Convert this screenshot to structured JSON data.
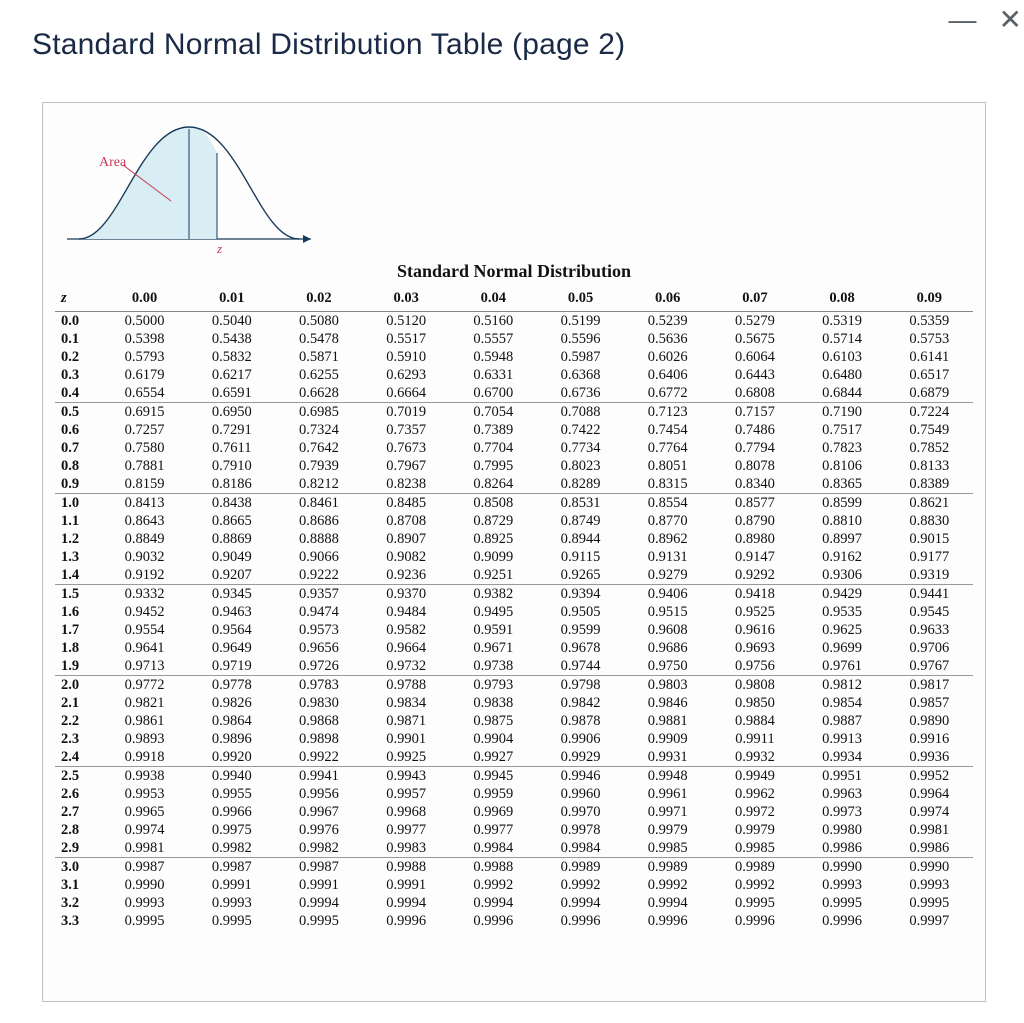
{
  "window": {
    "minimize_glyph": "—",
    "close_glyph": "✕"
  },
  "title": "Standard Normal Distribution Table (page 2)",
  "diagram": {
    "area_label": "Area",
    "z_label": "z"
  },
  "table": {
    "title": "Standard Normal Distribution",
    "z_header": "z",
    "cols": [
      "0.00",
      "0.01",
      "0.02",
      "0.03",
      "0.04",
      "0.05",
      "0.06",
      "0.07",
      "0.08",
      "0.09"
    ],
    "groups": [
      {
        "rows": [
          {
            "z": "0.0",
            "v": [
              "0.5000",
              "0.5040",
              "0.5080",
              "0.5120",
              "0.5160",
              "0.5199",
              "0.5239",
              "0.5279",
              "0.5319",
              "0.5359"
            ]
          },
          {
            "z": "0.1",
            "v": [
              "0.5398",
              "0.5438",
              "0.5478",
              "0.5517",
              "0.5557",
              "0.5596",
              "0.5636",
              "0.5675",
              "0.5714",
              "0.5753"
            ]
          },
          {
            "z": "0.2",
            "v": [
              "0.5793",
              "0.5832",
              "0.5871",
              "0.5910",
              "0.5948",
              "0.5987",
              "0.6026",
              "0.6064",
              "0.6103",
              "0.6141"
            ]
          },
          {
            "z": "0.3",
            "v": [
              "0.6179",
              "0.6217",
              "0.6255",
              "0.6293",
              "0.6331",
              "0.6368",
              "0.6406",
              "0.6443",
              "0.6480",
              "0.6517"
            ]
          },
          {
            "z": "0.4",
            "v": [
              "0.6554",
              "0.6591",
              "0.6628",
              "0.6664",
              "0.6700",
              "0.6736",
              "0.6772",
              "0.6808",
              "0.6844",
              "0.6879"
            ]
          }
        ]
      },
      {
        "rows": [
          {
            "z": "0.5",
            "v": [
              "0.6915",
              "0.6950",
              "0.6985",
              "0.7019",
              "0.7054",
              "0.7088",
              "0.7123",
              "0.7157",
              "0.7190",
              "0.7224"
            ]
          },
          {
            "z": "0.6",
            "v": [
              "0.7257",
              "0.7291",
              "0.7324",
              "0.7357",
              "0.7389",
              "0.7422",
              "0.7454",
              "0.7486",
              "0.7517",
              "0.7549"
            ]
          },
          {
            "z": "0.7",
            "v": [
              "0.7580",
              "0.7611",
              "0.7642",
              "0.7673",
              "0.7704",
              "0.7734",
              "0.7764",
              "0.7794",
              "0.7823",
              "0.7852"
            ]
          },
          {
            "z": "0.8",
            "v": [
              "0.7881",
              "0.7910",
              "0.7939",
              "0.7967",
              "0.7995",
              "0.8023",
              "0.8051",
              "0.8078",
              "0.8106",
              "0.8133"
            ]
          },
          {
            "z": "0.9",
            "v": [
              "0.8159",
              "0.8186",
              "0.8212",
              "0.8238",
              "0.8264",
              "0.8289",
              "0.8315",
              "0.8340",
              "0.8365",
              "0.8389"
            ]
          }
        ]
      },
      {
        "rows": [
          {
            "z": "1.0",
            "v": [
              "0.8413",
              "0.8438",
              "0.8461",
              "0.8485",
              "0.8508",
              "0.8531",
              "0.8554",
              "0.8577",
              "0.8599",
              "0.8621"
            ]
          },
          {
            "z": "1.1",
            "v": [
              "0.8643",
              "0.8665",
              "0.8686",
              "0.8708",
              "0.8729",
              "0.8749",
              "0.8770",
              "0.8790",
              "0.8810",
              "0.8830"
            ]
          },
          {
            "z": "1.2",
            "v": [
              "0.8849",
              "0.8869",
              "0.8888",
              "0.8907",
              "0.8925",
              "0.8944",
              "0.8962",
              "0.8980",
              "0.8997",
              "0.9015"
            ]
          },
          {
            "z": "1.3",
            "v": [
              "0.9032",
              "0.9049",
              "0.9066",
              "0.9082",
              "0.9099",
              "0.9115",
              "0.9131",
              "0.9147",
              "0.9162",
              "0.9177"
            ]
          },
          {
            "z": "1.4",
            "v": [
              "0.9192",
              "0.9207",
              "0.9222",
              "0.9236",
              "0.9251",
              "0.9265",
              "0.9279",
              "0.9292",
              "0.9306",
              "0.9319"
            ]
          }
        ]
      },
      {
        "rows": [
          {
            "z": "1.5",
            "v": [
              "0.9332",
              "0.9345",
              "0.9357",
              "0.9370",
              "0.9382",
              "0.9394",
              "0.9406",
              "0.9418",
              "0.9429",
              "0.9441"
            ]
          },
          {
            "z": "1.6",
            "v": [
              "0.9452",
              "0.9463",
              "0.9474",
              "0.9484",
              "0.9495",
              "0.9505",
              "0.9515",
              "0.9525",
              "0.9535",
              "0.9545"
            ]
          },
          {
            "z": "1.7",
            "v": [
              "0.9554",
              "0.9564",
              "0.9573",
              "0.9582",
              "0.9591",
              "0.9599",
              "0.9608",
              "0.9616",
              "0.9625",
              "0.9633"
            ]
          },
          {
            "z": "1.8",
            "v": [
              "0.9641",
              "0.9649",
              "0.9656",
              "0.9664",
              "0.9671",
              "0.9678",
              "0.9686",
              "0.9693",
              "0.9699",
              "0.9706"
            ]
          },
          {
            "z": "1.9",
            "v": [
              "0.9713",
              "0.9719",
              "0.9726",
              "0.9732",
              "0.9738",
              "0.9744",
              "0.9750",
              "0.9756",
              "0.9761",
              "0.9767"
            ]
          }
        ]
      },
      {
        "rows": [
          {
            "z": "2.0",
            "v": [
              "0.9772",
              "0.9778",
              "0.9783",
              "0.9788",
              "0.9793",
              "0.9798",
              "0.9803",
              "0.9808",
              "0.9812",
              "0.9817"
            ]
          },
          {
            "z": "2.1",
            "v": [
              "0.9821",
              "0.9826",
              "0.9830",
              "0.9834",
              "0.9838",
              "0.9842",
              "0.9846",
              "0.9850",
              "0.9854",
              "0.9857"
            ]
          },
          {
            "z": "2.2",
            "v": [
              "0.9861",
              "0.9864",
              "0.9868",
              "0.9871",
              "0.9875",
              "0.9878",
              "0.9881",
              "0.9884",
              "0.9887",
              "0.9890"
            ]
          },
          {
            "z": "2.3",
            "v": [
              "0.9893",
              "0.9896",
              "0.9898",
              "0.9901",
              "0.9904",
              "0.9906",
              "0.9909",
              "0.9911",
              "0.9913",
              "0.9916"
            ]
          },
          {
            "z": "2.4",
            "v": [
              "0.9918",
              "0.9920",
              "0.9922",
              "0.9925",
              "0.9927",
              "0.9929",
              "0.9931",
              "0.9932",
              "0.9934",
              "0.9936"
            ]
          }
        ]
      },
      {
        "rows": [
          {
            "z": "2.5",
            "v": [
              "0.9938",
              "0.9940",
              "0.9941",
              "0.9943",
              "0.9945",
              "0.9946",
              "0.9948",
              "0.9949",
              "0.9951",
              "0.9952"
            ]
          },
          {
            "z": "2.6",
            "v": [
              "0.9953",
              "0.9955",
              "0.9956",
              "0.9957",
              "0.9959",
              "0.9960",
              "0.9961",
              "0.9962",
              "0.9963",
              "0.9964"
            ]
          },
          {
            "z": "2.7",
            "v": [
              "0.9965",
              "0.9966",
              "0.9967",
              "0.9968",
              "0.9969",
              "0.9970",
              "0.9971",
              "0.9972",
              "0.9973",
              "0.9974"
            ]
          },
          {
            "z": "2.8",
            "v": [
              "0.9974",
              "0.9975",
              "0.9976",
              "0.9977",
              "0.9977",
              "0.9978",
              "0.9979",
              "0.9979",
              "0.9980",
              "0.9981"
            ]
          },
          {
            "z": "2.9",
            "v": [
              "0.9981",
              "0.9982",
              "0.9982",
              "0.9983",
              "0.9984",
              "0.9984",
              "0.9985",
              "0.9985",
              "0.9986",
              "0.9986"
            ]
          }
        ]
      },
      {
        "rows": [
          {
            "z": "3.0",
            "v": [
              "0.9987",
              "0.9987",
              "0.9987",
              "0.9988",
              "0.9988",
              "0.9989",
              "0.9989",
              "0.9989",
              "0.9990",
              "0.9990"
            ]
          },
          {
            "z": "3.1",
            "v": [
              "0.9990",
              "0.9991",
              "0.9991",
              "0.9991",
              "0.9992",
              "0.9992",
              "0.9992",
              "0.9992",
              "0.9993",
              "0.9993"
            ]
          },
          {
            "z": "3.2",
            "v": [
              "0.9993",
              "0.9993",
              "0.9994",
              "0.9994",
              "0.9994",
              "0.9994",
              "0.9994",
              "0.9995",
              "0.9995",
              "0.9995"
            ]
          },
          {
            "z": "3.3",
            "v": [
              "0.9995",
              "0.9995",
              "0.9995",
              "0.9996",
              "0.9996",
              "0.9996",
              "0.9996",
              "0.9996",
              "0.9996",
              "0.9997"
            ]
          }
        ]
      }
    ]
  },
  "chart_data": {
    "type": "table",
    "description": "Cumulative standard normal distribution P(Z ≤ z) for z from 0.0 to 3.3 in steps of 0.1 (rows) and second decimal 0.00–0.09 (columns).",
    "z_row_step": 0.1,
    "z_col_step": 0.01,
    "z_range": [
      0.0,
      3.39
    ],
    "columns": [
      "0.00",
      "0.01",
      "0.02",
      "0.03",
      "0.04",
      "0.05",
      "0.06",
      "0.07",
      "0.08",
      "0.09"
    ]
  }
}
